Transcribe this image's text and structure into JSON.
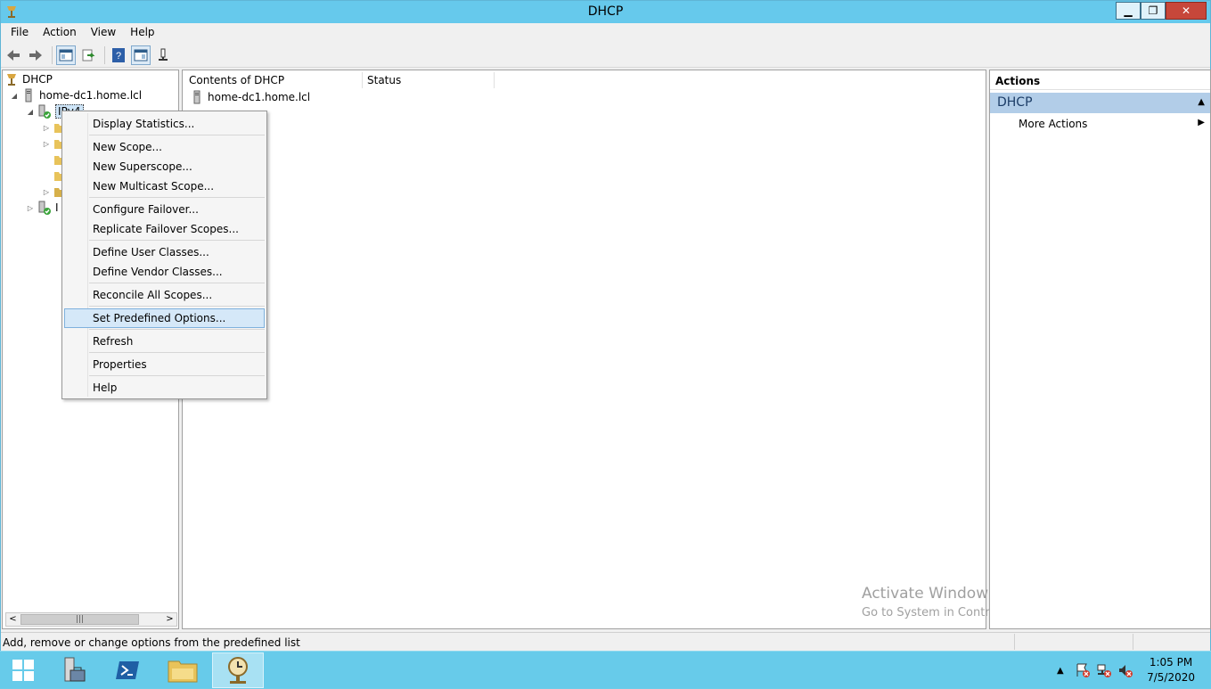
{
  "window": {
    "title": "DHCP"
  },
  "menubar": [
    "File",
    "Action",
    "View",
    "Help"
  ],
  "tree": {
    "root": "DHCP",
    "server": "home-dc1.home.lcl",
    "ipv4": "IPv4",
    "ipv6_partial": "I"
  },
  "content": {
    "columns": [
      "Contents of DHCP",
      "Status"
    ],
    "rows": [
      {
        "name": "home-dc1.home.lcl",
        "status": ""
      }
    ]
  },
  "actions": {
    "header": "Actions",
    "section": "DHCP",
    "item": "More Actions"
  },
  "context_menu": {
    "items": [
      "Display Statistics...",
      "New Scope...",
      "New Superscope...",
      "New Multicast Scope...",
      "Configure Failover...",
      "Replicate Failover Scopes...",
      "Define User Classes...",
      "Define Vendor Classes...",
      "Reconcile All Scopes...",
      "Set Predefined Options...",
      "Refresh",
      "Properties",
      "Help"
    ],
    "highlighted": "Set Predefined Options..."
  },
  "watermark": {
    "line1": "Activate Windows",
    "line2": "Go to System in Control Panel to activate Windows."
  },
  "statusbar": {
    "text": "Add, remove or change options from the predefined list"
  },
  "taskbar": {
    "time": "1:05 PM",
    "date": "7/5/2020"
  },
  "colors": {
    "title_bar": "#66c9ec",
    "taskbar": "#67cbea",
    "menu_highlight": "#d5e8f8",
    "actions_section": "#b2cde8"
  }
}
